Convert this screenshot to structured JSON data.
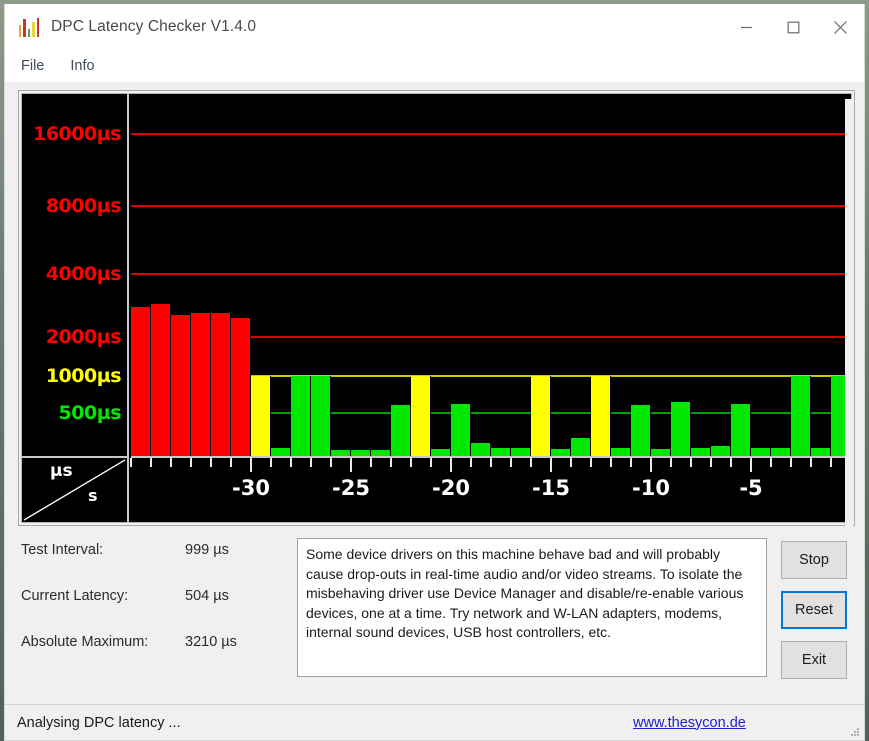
{
  "window": {
    "title": "DPC Latency Checker V1.4.0",
    "icon": "bar-chart-icon",
    "controls": {
      "minimize": "minimize-icon",
      "maximize": "maximize-icon",
      "close": "close-icon"
    }
  },
  "menu": {
    "items": [
      {
        "label": "File"
      },
      {
        "label": "Info"
      }
    ]
  },
  "stats": {
    "rows": [
      {
        "label": "Test Interval:",
        "value": "999 µs"
      },
      {
        "label": "Current Latency:",
        "value": "504 µs"
      },
      {
        "label": "Absolute Maximum:",
        "value": "3210 µs"
      }
    ]
  },
  "description": {
    "text": "Some device drivers on this machine behave bad and will probably cause drop-outs in real-time audio and/or video streams. To isolate the misbehaving driver use Device Manager and disable/re-enable various devices, one at a time. Try network and W-LAN adapters, modems, internal sound devices, USB host controllers, etc."
  },
  "buttons": {
    "stop": "Stop",
    "reset": "Reset",
    "exit": "Exit",
    "focused": "reset"
  },
  "statusbar": {
    "text": "Analysing DPC latency ...",
    "link": "www.thesycon.de"
  },
  "colors": {
    "red": "#FF0000",
    "yellow": "#FFFF00",
    "green": "#00E800",
    "gridline_red": "#E00000",
    "gridline_yellow": "#C8C800",
    "gridline_green": "#00A000",
    "plot_background": "#000000",
    "accent_focus": "#0078D7",
    "link": "#2020D0"
  },
  "chart_data": {
    "type": "bar",
    "title": "DPC latency history",
    "xlabel": "s",
    "ylabel": "µs",
    "grid": true,
    "legend": false,
    "yscale": "log-like-segmented",
    "ylim": [
      0,
      20000
    ],
    "y_ticks": [
      {
        "value": 16000,
        "label": "16000µs",
        "color": "#FF0000",
        "pos_pct": 10.8
      },
      {
        "value": 8000,
        "label": "8000µs",
        "color": "#FF0000",
        "pos_pct": 30.4
      },
      {
        "value": 4000,
        "label": "4000µs",
        "color": "#FF0000",
        "pos_pct": 48.7
      },
      {
        "value": 2000,
        "label": "2000µs",
        "color": "#FF0000",
        "pos_pct": 65.9
      },
      {
        "value": 1000,
        "label": "1000µs",
        "color": "#FFFF00",
        "pos_pct": 76.3
      },
      {
        "value": 500,
        "label": "500µs",
        "color": "#00E800",
        "pos_pct": 86.4
      }
    ],
    "x_ticks": [
      {
        "value": -30,
        "label": "-30"
      },
      {
        "value": -25,
        "label": "-25"
      },
      {
        "value": -20,
        "label": "-20"
      },
      {
        "value": -15,
        "label": "-15"
      },
      {
        "value": -10,
        "label": "-10"
      },
      {
        "value": -5,
        "label": "-5"
      }
    ],
    "x_unit": "s",
    "bar_count": 36,
    "categories": [
      -35.5,
      -34.5,
      -33.5,
      -32.5,
      -31.5,
      -30.5,
      -29.5,
      -28.5,
      -27.5,
      -26.5,
      -25.5,
      -24.5,
      -23.5,
      -22.5,
      -21.5,
      -20.5,
      -19.5,
      -18.5,
      -17.5,
      -16.5,
      -15.5,
      -14.5,
      -13.5,
      -12.5,
      -11.5,
      -10.5,
      -9.5,
      -8.5,
      -7.5,
      -6.5,
      -5.5,
      -4.5,
      -3.5,
      -2.5,
      -1.5,
      -0.5
    ],
    "values": [
      2950,
      3050,
      2700,
      2750,
      2750,
      2600,
      1000,
      150,
      1000,
      1000,
      130,
      130,
      130,
      600,
      1000,
      140,
      620,
      200,
      150,
      150,
      1000,
      140,
      250,
      1000,
      150,
      600,
      140,
      640,
      150,
      170,
      620,
      150,
      150,
      1000,
      150,
      1000
    ],
    "bar_colors": [
      "#FF0000",
      "#FF0000",
      "#FF0000",
      "#FF0000",
      "#FF0000",
      "#FF0000",
      "#FFFF00",
      "#00E800",
      "#00E800",
      "#00E800",
      "#00E800",
      "#00E800",
      "#00E800",
      "#00E800",
      "#FFFF00",
      "#00E800",
      "#00E800",
      "#00E800",
      "#00E800",
      "#00E800",
      "#FFFF00",
      "#00E800",
      "#00E800",
      "#FFFF00",
      "#00E800",
      "#00E800",
      "#00E800",
      "#00E800",
      "#00E800",
      "#00E800",
      "#00E800",
      "#00E800",
      "#00E800",
      "#00E800",
      "#00E800",
      "#00E800"
    ],
    "thresholds": {
      "green_max": 500,
      "yellow_max": 1000,
      "red_min": 2000
    }
  }
}
